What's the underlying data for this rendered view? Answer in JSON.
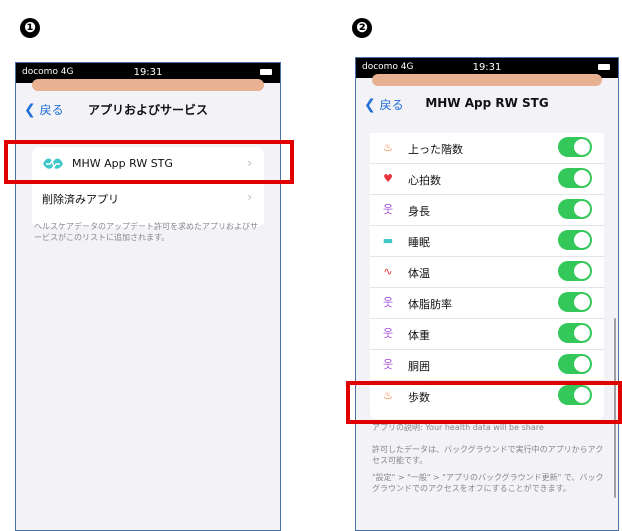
{
  "steps": [
    "❶",
    "❷"
  ],
  "screen1": {
    "carrier": "docomo 4G",
    "time": "19:31",
    "back_label": "戻る",
    "title": "アプリおよびサービス",
    "app_item": "MHW App RW STG",
    "removed_item": "削除済みアプリ",
    "note": "ヘルスケアデータのアップデート許可を求めたアプリおよびサービスがこのリストに追加されます。"
  },
  "screen2": {
    "carrier": "docomo 4G",
    "time": "19:31",
    "back_label": "戻る",
    "title": "MHW App RW STG",
    "rows": [
      {
        "label": "上った階数",
        "icon": "flame-icon",
        "color": "#f06a1c",
        "on": true
      },
      {
        "label": "心拍数",
        "icon": "heart-icon",
        "color": "#e8343f",
        "on": true
      },
      {
        "label": "身長",
        "icon": "person-icon",
        "color": "#a24fd6",
        "on": true
      },
      {
        "label": "睡眠",
        "icon": "bed-icon",
        "color": "#3fc7c9",
        "on": true
      },
      {
        "label": "体温",
        "icon": "thermometer-icon",
        "color": "#e8343f",
        "on": true
      },
      {
        "label": "体脂肪率",
        "icon": "person-icon",
        "color": "#a24fd6",
        "on": true
      },
      {
        "label": "体重",
        "icon": "person-icon",
        "color": "#a24fd6",
        "on": true
      },
      {
        "label": "胴囲",
        "icon": "person-icon",
        "color": "#a24fd6",
        "on": true
      },
      {
        "label": "歩数",
        "icon": "flame-icon",
        "color": "#f06a1c",
        "on": true
      }
    ],
    "description": "アプリの説明: Your health data will be share",
    "note1": "許可したデータは、バックグラウンドで実行中のアプリからアクセス可能です。",
    "note2": "\"設定\" > \"一般\" > \"アプリのバックグラウンド更新\" で、バックグラウンドでのアクセスをオフにすることができます。"
  },
  "colors": {
    "accent": "#1f6fd6",
    "toggle_on": "#34c759",
    "highlight": "#e00000",
    "logo": "#3fc7c9"
  }
}
